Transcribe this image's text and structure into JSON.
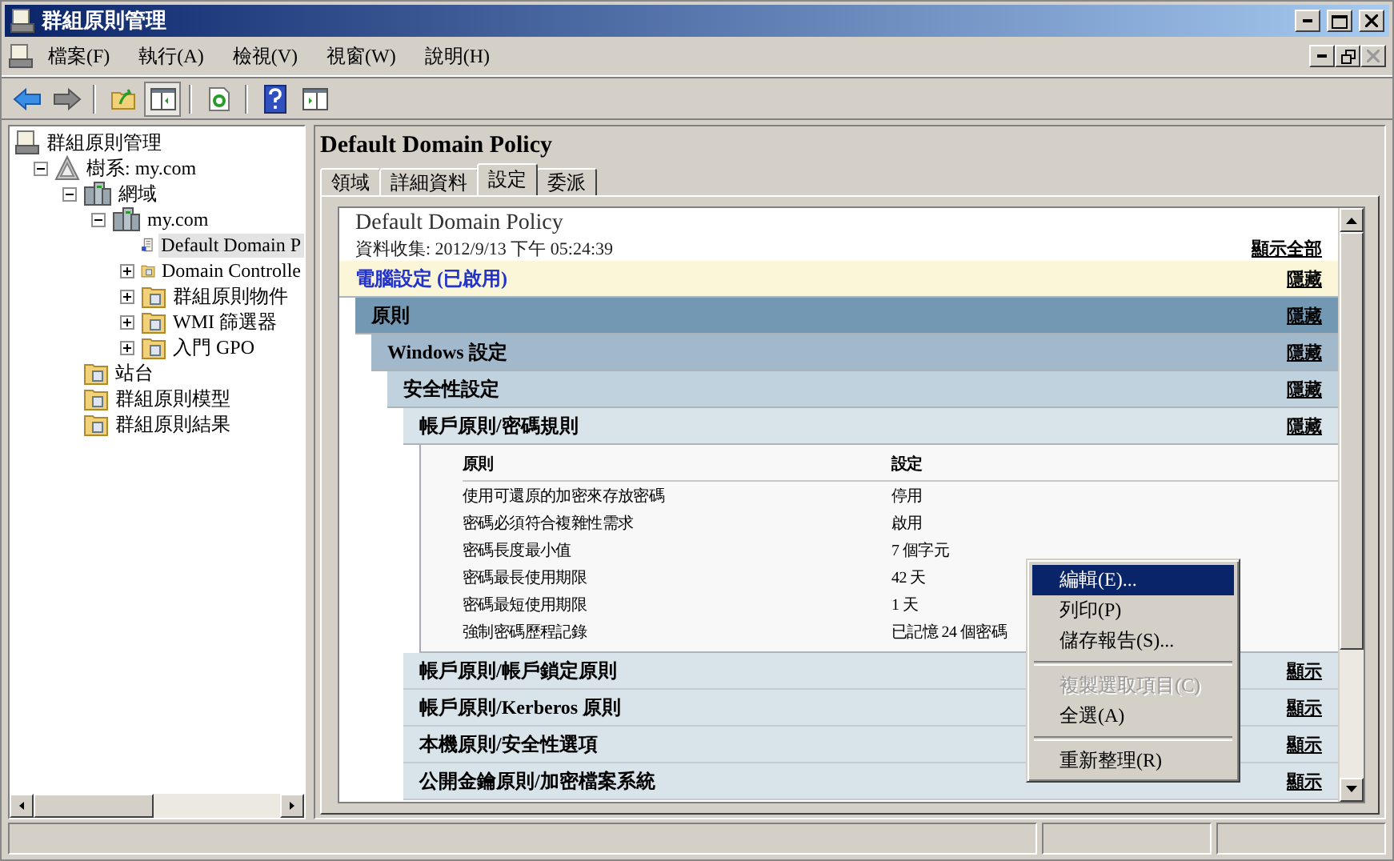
{
  "window": {
    "title": "群組原則管理"
  },
  "menu": [
    "檔案(F)",
    "執行(A)",
    "檢視(V)",
    "視窗(W)",
    "說明(H)"
  ],
  "toolbar": [
    {
      "kind": "back",
      "pressed": false
    },
    {
      "kind": "forward",
      "pressed": false
    },
    {
      "kind": "sep"
    },
    {
      "kind": "up",
      "pressed": false
    },
    {
      "kind": "pane",
      "pressed": true
    },
    {
      "kind": "sep"
    },
    {
      "kind": "refresh",
      "pressed": false
    },
    {
      "kind": "sep"
    },
    {
      "kind": "help",
      "pressed": false
    },
    {
      "kind": "action",
      "pressed": false
    }
  ],
  "tree": [
    {
      "label": "群組原則管理",
      "kind": "console",
      "selected": false,
      "children": [
        {
          "label": "樹系: my.com",
          "kind": "forest",
          "selected": false,
          "expanded": true,
          "children": [
            {
              "label": "網域",
              "kind": "servers",
              "selected": false,
              "expanded": true,
              "children": [
                {
                  "label": "my.com",
                  "kind": "servers",
                  "selected": false,
                  "expanded": true,
                  "children": [
                    {
                      "label": "Default Domain P",
                      "kind": "gpo",
                      "selected": true
                    },
                    {
                      "label": "Domain Controlle",
                      "kind": "folder",
                      "selected": false,
                      "expanded": false
                    },
                    {
                      "label": "群組原則物件",
                      "kind": "folder",
                      "selected": false,
                      "expanded": false
                    },
                    {
                      "label": "WMI 篩選器",
                      "kind": "folder",
                      "selected": false,
                      "expanded": false
                    },
                    {
                      "label": "入門 GPO",
                      "kind": "folder",
                      "selected": false,
                      "expanded": false
                    }
                  ]
                }
              ]
            },
            {
              "label": "站台",
              "kind": "folder",
              "selected": false
            },
            {
              "label": "群組原則模型",
              "kind": "folder",
              "selected": false
            },
            {
              "label": "群組原則結果",
              "kind": "folder",
              "selected": false
            }
          ]
        }
      ]
    }
  ],
  "pane_title": "Default Domain Policy",
  "tabs": [
    {
      "label": "領域",
      "selected": false
    },
    {
      "label": "詳細資料",
      "selected": false
    },
    {
      "label": "設定",
      "selected": true
    },
    {
      "label": "委派",
      "selected": false
    }
  ],
  "report": {
    "title": "Default Domain Policy",
    "collected": "資料收集: 2012/9/13 下午 05:24:39",
    "show_all": "顯示全部",
    "sections": [
      {
        "label": "電腦設定 (已啟用)",
        "toggle": "隱藏",
        "expanded": true,
        "children": [
          {
            "label": "原則",
            "toggle": "隱藏",
            "expanded": true,
            "children": [
              {
                "label": "Windows 設定",
                "toggle": "隱藏",
                "expanded": true,
                "children": [
                  {
                    "label": "安全性設定",
                    "toggle": "隱藏",
                    "expanded": true,
                    "children": [
                      {
                        "label": "帳戶原則/密碼規則",
                        "toggle": "隱藏",
                        "expanded": true,
                        "table": {
                          "columns": [
                            "原則",
                            "設定"
                          ],
                          "rows": [
                            [
                              "使用可還原的加密來存放密碼",
                              "停用"
                            ],
                            [
                              "密碼必須符合複雜性需求",
                              "啟用"
                            ],
                            [
                              "密碼長度最小值",
                              "7 個字元"
                            ],
                            [
                              "密碼最長使用期限",
                              "42 天"
                            ],
                            [
                              "密碼最短使用期限",
                              "1 天"
                            ],
                            [
                              "強制密碼歷程記錄",
                              "已記憶 24 個密碼"
                            ]
                          ]
                        }
                      },
                      {
                        "label": "帳戶原則/帳戶鎖定原則",
                        "toggle": "顯示",
                        "expanded": false
                      },
                      {
                        "label": "帳戶原則/Kerberos 原則",
                        "toggle": "顯示",
                        "expanded": false
                      },
                      {
                        "label": "本機原則/安全性選項",
                        "toggle": "顯示",
                        "expanded": false
                      },
                      {
                        "label": "公開金鑰原則/加密檔案系統",
                        "toggle": "顯示",
                        "expanded": false
                      }
                    ]
                  }
                ]
              }
            ]
          }
        ]
      }
    ]
  },
  "context_menu": [
    {
      "kind": "item",
      "label": "編輯(E)...",
      "selected": true,
      "disabled": false
    },
    {
      "kind": "item",
      "label": "列印(P)",
      "selected": false,
      "disabled": false
    },
    {
      "kind": "item",
      "label": "儲存報告(S)...",
      "selected": false,
      "disabled": false
    },
    {
      "kind": "separator"
    },
    {
      "kind": "item",
      "label": "複製選取項目(C)",
      "selected": false,
      "disabled": true
    },
    {
      "kind": "item",
      "label": "全選(A)",
      "selected": false,
      "disabled": false
    },
    {
      "kind": "separator"
    },
    {
      "kind": "item",
      "label": "重新整理(R)",
      "selected": false,
      "disabled": false
    }
  ]
}
